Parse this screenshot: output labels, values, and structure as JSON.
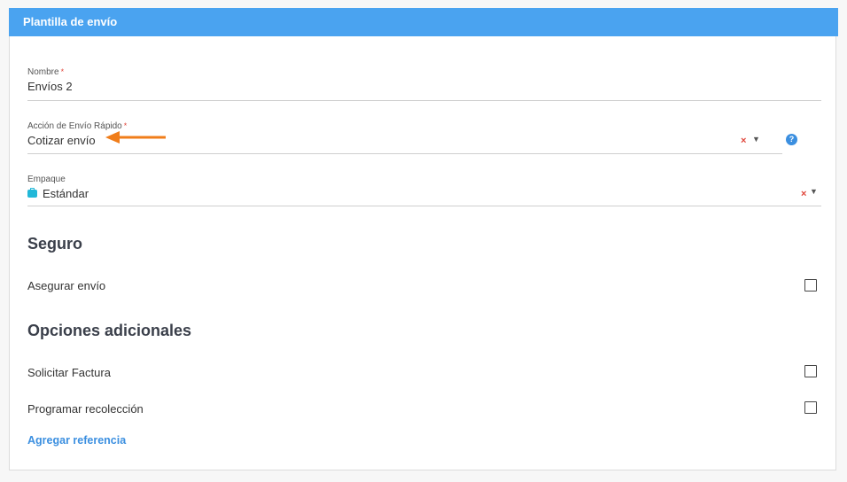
{
  "header": {
    "title": "Plantilla de envío"
  },
  "fields": {
    "nombre": {
      "label": "Nombre",
      "required_mark": "*",
      "value": "Envíos 2"
    },
    "accion": {
      "label": "Acción de Envío Rápido",
      "required_mark": "*",
      "value": "Cotizar envío",
      "help": "?"
    },
    "empaque": {
      "label": "Empaque",
      "value": "Estándar",
      "icon": "package-icon"
    }
  },
  "controls": {
    "clear_glyph": "×",
    "caret_glyph": "▼"
  },
  "sections": {
    "seguro": {
      "title": "Seguro",
      "items": [
        {
          "label": "Asegurar envío",
          "checked": false
        }
      ]
    },
    "opciones": {
      "title": "Opciones adicionales",
      "items": [
        {
          "label": "Solicitar Factura",
          "checked": false
        },
        {
          "label": "Programar recolección",
          "checked": false
        }
      ]
    }
  },
  "links": {
    "add_reference": "Agregar referencia"
  },
  "colors": {
    "header_bg": "#4aa3f0",
    "link": "#3b8fe0",
    "clear": "#e0453a",
    "annotation_arrow": "#f07d1a",
    "package_icon": "#22b8d8"
  }
}
